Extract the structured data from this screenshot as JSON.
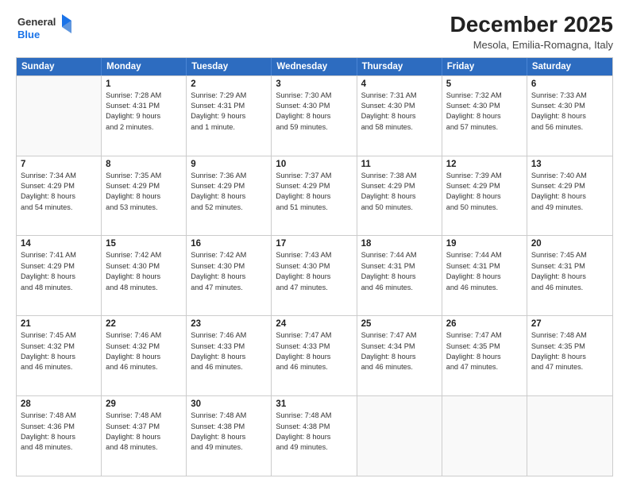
{
  "header": {
    "logo_line1": "General",
    "logo_line2": "Blue",
    "month": "December 2025",
    "location": "Mesola, Emilia-Romagna, Italy"
  },
  "days_of_week": [
    "Sunday",
    "Monday",
    "Tuesday",
    "Wednesday",
    "Thursday",
    "Friday",
    "Saturday"
  ],
  "weeks": [
    [
      {
        "day": "",
        "info": ""
      },
      {
        "day": "1",
        "info": "Sunrise: 7:28 AM\nSunset: 4:31 PM\nDaylight: 9 hours\nand 2 minutes."
      },
      {
        "day": "2",
        "info": "Sunrise: 7:29 AM\nSunset: 4:31 PM\nDaylight: 9 hours\nand 1 minute."
      },
      {
        "day": "3",
        "info": "Sunrise: 7:30 AM\nSunset: 4:30 PM\nDaylight: 8 hours\nand 59 minutes."
      },
      {
        "day": "4",
        "info": "Sunrise: 7:31 AM\nSunset: 4:30 PM\nDaylight: 8 hours\nand 58 minutes."
      },
      {
        "day": "5",
        "info": "Sunrise: 7:32 AM\nSunset: 4:30 PM\nDaylight: 8 hours\nand 57 minutes."
      },
      {
        "day": "6",
        "info": "Sunrise: 7:33 AM\nSunset: 4:30 PM\nDaylight: 8 hours\nand 56 minutes."
      }
    ],
    [
      {
        "day": "7",
        "info": "Sunrise: 7:34 AM\nSunset: 4:29 PM\nDaylight: 8 hours\nand 54 minutes."
      },
      {
        "day": "8",
        "info": "Sunrise: 7:35 AM\nSunset: 4:29 PM\nDaylight: 8 hours\nand 53 minutes."
      },
      {
        "day": "9",
        "info": "Sunrise: 7:36 AM\nSunset: 4:29 PM\nDaylight: 8 hours\nand 52 minutes."
      },
      {
        "day": "10",
        "info": "Sunrise: 7:37 AM\nSunset: 4:29 PM\nDaylight: 8 hours\nand 51 minutes."
      },
      {
        "day": "11",
        "info": "Sunrise: 7:38 AM\nSunset: 4:29 PM\nDaylight: 8 hours\nand 50 minutes."
      },
      {
        "day": "12",
        "info": "Sunrise: 7:39 AM\nSunset: 4:29 PM\nDaylight: 8 hours\nand 50 minutes."
      },
      {
        "day": "13",
        "info": "Sunrise: 7:40 AM\nSunset: 4:29 PM\nDaylight: 8 hours\nand 49 minutes."
      }
    ],
    [
      {
        "day": "14",
        "info": "Sunrise: 7:41 AM\nSunset: 4:29 PM\nDaylight: 8 hours\nand 48 minutes."
      },
      {
        "day": "15",
        "info": "Sunrise: 7:42 AM\nSunset: 4:30 PM\nDaylight: 8 hours\nand 48 minutes."
      },
      {
        "day": "16",
        "info": "Sunrise: 7:42 AM\nSunset: 4:30 PM\nDaylight: 8 hours\nand 47 minutes."
      },
      {
        "day": "17",
        "info": "Sunrise: 7:43 AM\nSunset: 4:30 PM\nDaylight: 8 hours\nand 47 minutes."
      },
      {
        "day": "18",
        "info": "Sunrise: 7:44 AM\nSunset: 4:31 PM\nDaylight: 8 hours\nand 46 minutes."
      },
      {
        "day": "19",
        "info": "Sunrise: 7:44 AM\nSunset: 4:31 PM\nDaylight: 8 hours\nand 46 minutes."
      },
      {
        "day": "20",
        "info": "Sunrise: 7:45 AM\nSunset: 4:31 PM\nDaylight: 8 hours\nand 46 minutes."
      }
    ],
    [
      {
        "day": "21",
        "info": "Sunrise: 7:45 AM\nSunset: 4:32 PM\nDaylight: 8 hours\nand 46 minutes."
      },
      {
        "day": "22",
        "info": "Sunrise: 7:46 AM\nSunset: 4:32 PM\nDaylight: 8 hours\nand 46 minutes."
      },
      {
        "day": "23",
        "info": "Sunrise: 7:46 AM\nSunset: 4:33 PM\nDaylight: 8 hours\nand 46 minutes."
      },
      {
        "day": "24",
        "info": "Sunrise: 7:47 AM\nSunset: 4:33 PM\nDaylight: 8 hours\nand 46 minutes."
      },
      {
        "day": "25",
        "info": "Sunrise: 7:47 AM\nSunset: 4:34 PM\nDaylight: 8 hours\nand 46 minutes."
      },
      {
        "day": "26",
        "info": "Sunrise: 7:47 AM\nSunset: 4:35 PM\nDaylight: 8 hours\nand 47 minutes."
      },
      {
        "day": "27",
        "info": "Sunrise: 7:48 AM\nSunset: 4:35 PM\nDaylight: 8 hours\nand 47 minutes."
      }
    ],
    [
      {
        "day": "28",
        "info": "Sunrise: 7:48 AM\nSunset: 4:36 PM\nDaylight: 8 hours\nand 48 minutes."
      },
      {
        "day": "29",
        "info": "Sunrise: 7:48 AM\nSunset: 4:37 PM\nDaylight: 8 hours\nand 48 minutes."
      },
      {
        "day": "30",
        "info": "Sunrise: 7:48 AM\nSunset: 4:38 PM\nDaylight: 8 hours\nand 49 minutes."
      },
      {
        "day": "31",
        "info": "Sunrise: 7:48 AM\nSunset: 4:38 PM\nDaylight: 8 hours\nand 49 minutes."
      },
      {
        "day": "",
        "info": ""
      },
      {
        "day": "",
        "info": ""
      },
      {
        "day": "",
        "info": ""
      }
    ]
  ]
}
